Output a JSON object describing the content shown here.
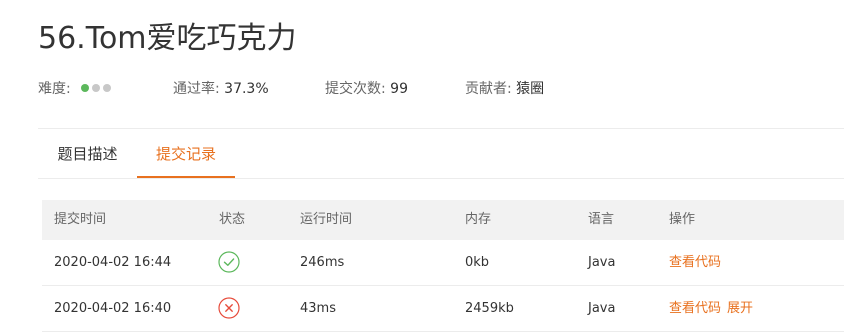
{
  "problem": {
    "title": "56.Tom爱吃巧克力",
    "difficulty_label": "难度:",
    "difficulty_dots": [
      "#5cb85c",
      "#c8c8c8",
      "#c8c8c8"
    ],
    "pass_rate_label": "通过率:",
    "pass_rate_value": "37.3%",
    "submissions_label": "提交次数:",
    "submissions_value": "99",
    "contributor_label": "贡献者:",
    "contributor_value": "猿圈"
  },
  "tabs": [
    {
      "label": "题目描述",
      "active": false
    },
    {
      "label": "提交记录",
      "active": true
    }
  ],
  "colors": {
    "accent": "#e8711f",
    "success": "#5cb85c",
    "error": "#e74c3c"
  },
  "table": {
    "headers": [
      "提交时间",
      "状态",
      "运行时间",
      "内存",
      "语言",
      "操作"
    ],
    "rows": [
      {
        "time": "2020-04-02 16:44",
        "status_icon": "check-circle-icon",
        "runtime": "246ms",
        "memory": "0kb",
        "language": "Java",
        "actions": [
          "查看代码"
        ]
      },
      {
        "time": "2020-04-02 16:40",
        "status_icon": "cross-circle-icon",
        "runtime": "43ms",
        "memory": "2459kb",
        "language": "Java",
        "actions": [
          "查看代码",
          "展开"
        ]
      }
    ]
  }
}
